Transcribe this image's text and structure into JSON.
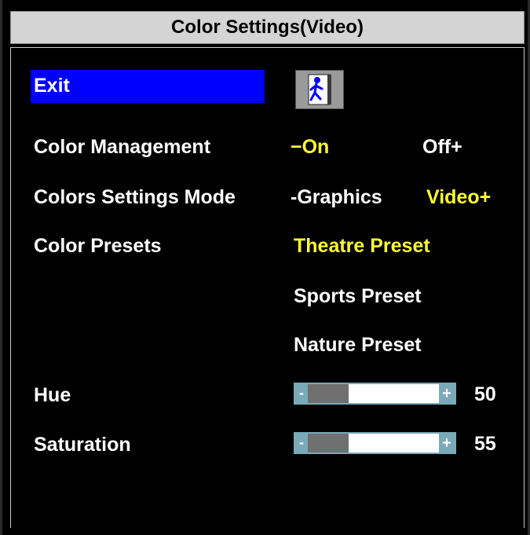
{
  "window": {
    "title": "Color Settings(Video)"
  },
  "menu": {
    "exit": {
      "label": "Exit",
      "icon": "exit-door-icon"
    },
    "color_management": {
      "label": "Color Management",
      "option_on": "−On",
      "option_off": "Off+",
      "selected": "On"
    },
    "color_settings_mode": {
      "label": "Colors Settings Mode",
      "option_graphics": "-Graphics",
      "option_video": "Video+",
      "selected": "Video"
    },
    "color_presets": {
      "label": "Color Presets",
      "options": [
        "Theatre Preset",
        "Sports Preset",
        "Nature Preset"
      ],
      "selected": "Theatre Preset"
    },
    "hue": {
      "label": "Hue",
      "value": "50",
      "level": 0.5,
      "minus": "-",
      "plus": "+"
    },
    "saturation": {
      "label": "Saturation",
      "value": "55",
      "level": 0.55,
      "minus": "-",
      "plus": "+"
    }
  },
  "colors": {
    "highlight": "#0000ff",
    "selected_text": "#ffff33",
    "normal_text": "#ffffff",
    "background": "#000000",
    "title_bg": "#d4d4d4",
    "slider_fill": "#707070",
    "slider_cap": "#7aa9b8"
  }
}
